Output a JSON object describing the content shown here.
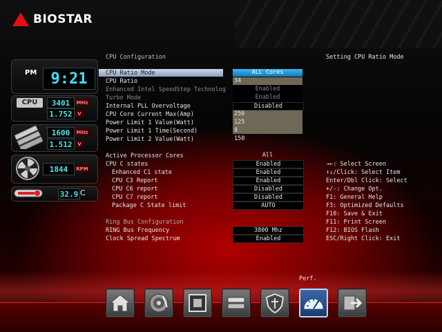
{
  "brand": {
    "name": "BIOSTAR"
  },
  "monitor": {
    "ampm": "PM",
    "clock": "9:21",
    "cpu_label": "CPU",
    "cpu_freq": "3401",
    "cpu_freq_unit": "MHz",
    "cpu_volt": "1.752",
    "cpu_volt_unit": "V",
    "mem_freq": "1600",
    "mem_freq_unit": "MHz",
    "mem_volt": "1.512",
    "mem_volt_unit": "V",
    "fan_rpm": "1844",
    "fan_unit": "RPM",
    "temp": "32.9",
    "temp_unit": "C"
  },
  "page": {
    "section_title": "CPU Configuration",
    "help_title": "Setting CPU Ratio Mode"
  },
  "settings": {
    "cpu_ratio_mode": {
      "label": "CPU Ratio Mode",
      "value": "ALL Cores"
    },
    "cpu_ratio": {
      "label": "CPU Ratio",
      "value": "34"
    },
    "speedstep": {
      "label": "Enhanced Intel SpeedStep Technolog",
      "value": "Enabled"
    },
    "turbo": {
      "label": "Turbo Mode",
      "value": "Enabled"
    },
    "pll": {
      "label": "Internal PLL Overvoltage",
      "value": "Disabled"
    },
    "core_current": {
      "label": "CPU Core Current Max(Amp)",
      "value": "256"
    },
    "pl1_value": {
      "label": "Power Limit 1 Value(Watt)",
      "value": "125"
    },
    "pl1_time": {
      "label": "Power Limit 1 Time(Second)",
      "value": "8"
    },
    "pl2_value": {
      "label": "Power Limit 2 Value(Watt)",
      "value": "150"
    },
    "active_cores": {
      "label": "Active Processor Cores",
      "value": "All"
    },
    "c_states": {
      "label": "CPU C states",
      "value": "Enabled"
    },
    "c1": {
      "label": "Enhanced C1 state",
      "value": "Enabled"
    },
    "c3": {
      "label": "CPU C3 Report",
      "value": "Enabled"
    },
    "c6": {
      "label": "CPU C6 report",
      "value": "Disabled"
    },
    "c7": {
      "label": "CPU C7 report",
      "value": "Disabled"
    },
    "pkg_c": {
      "label": "Package C State limit",
      "value": "AUTO"
    },
    "ring_section": "Ring Bus Configuration",
    "ring_freq": {
      "label": "RING Bus Frequency",
      "value": "3800 Mhz"
    },
    "spread": {
      "label": "Clock Spread Spectrum",
      "value": "Enabled"
    }
  },
  "help": [
    "→←: Select Screen",
    "↑↓/Click: Select Item",
    "Enter/Dbl Click: Select",
    "+/-: Change Opt.",
    "F1: General Help",
    "F3: Optimized Defaults",
    "F10: Save & Exit",
    "F11: Print Screen",
    "F12: BIOS Flash",
    "ESC/Right Click: Exit"
  ],
  "nav": {
    "active_label": "Perf.",
    "items": [
      "home-icon",
      "disk-icon",
      "chipset-icon",
      "storage-icon",
      "shield-icon",
      "performance-gauge-icon",
      "exit-icon"
    ]
  }
}
